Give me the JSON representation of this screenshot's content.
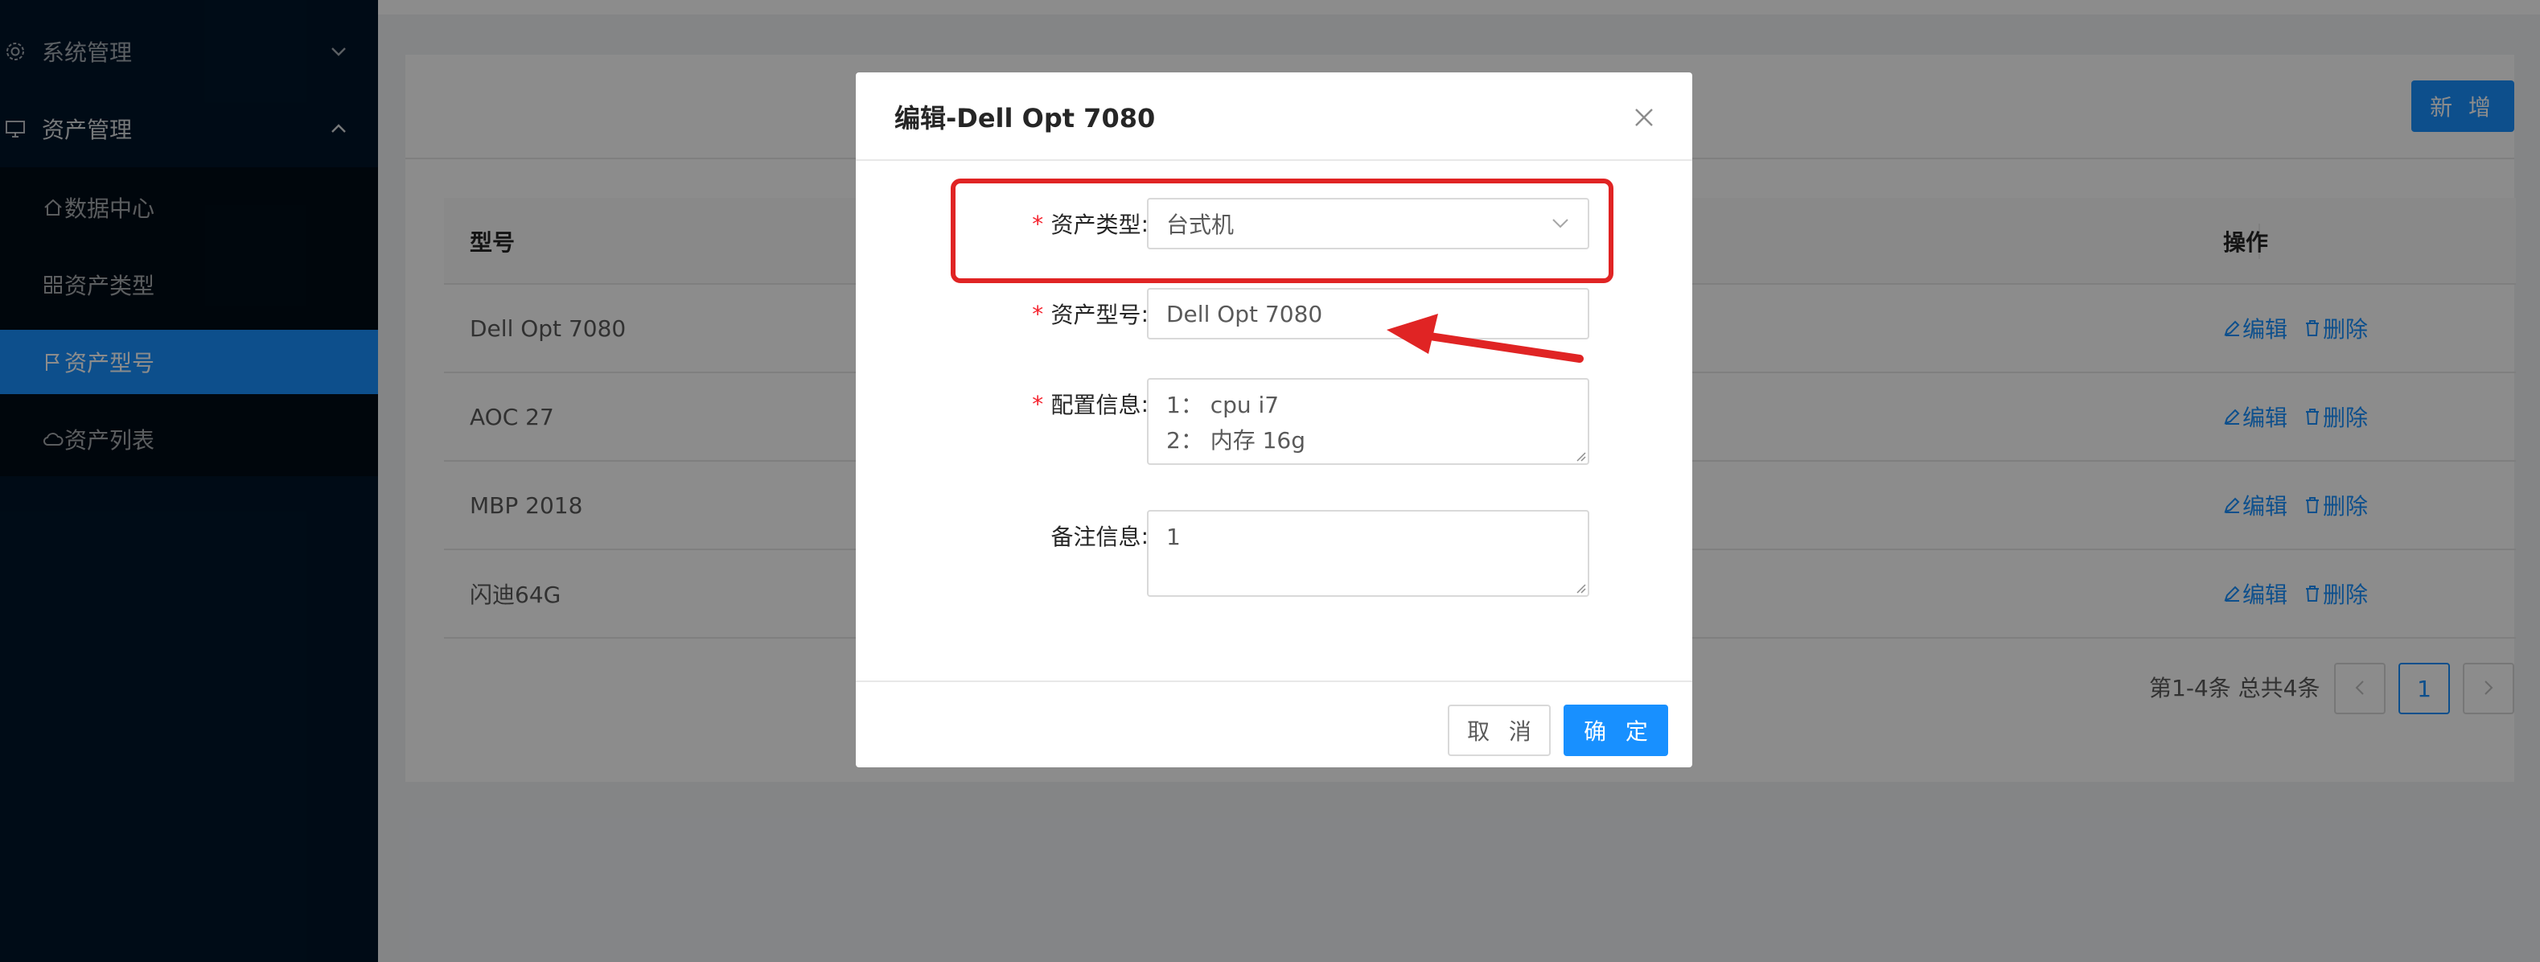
{
  "sidebar": {
    "system_menu": {
      "label": "系统管理",
      "icon": "gear-icon"
    },
    "asset_menu": {
      "label": "资产管理",
      "icon": "desktop-icon"
    },
    "items": [
      {
        "label": "数据中心",
        "icon": "home-icon"
      },
      {
        "label": "资产类型",
        "icon": "appstore-icon"
      },
      {
        "label": "资产型号",
        "icon": "flag-icon",
        "active": true
      },
      {
        "label": "资产列表",
        "icon": "cloud-icon"
      }
    ]
  },
  "toolbar": {
    "new_label": "新 增"
  },
  "table": {
    "columns": [
      "型号",
      "操作"
    ],
    "rows": [
      {
        "model": "Dell Opt 7080",
        "edit": "编辑",
        "delete": "删除"
      },
      {
        "model": "AOC 27",
        "edit": "编辑",
        "delete": "删除"
      },
      {
        "model": "MBP 2018",
        "edit": "编辑",
        "delete": "删除"
      },
      {
        "model": "闪迪64G",
        "edit": "编辑",
        "delete": "删除"
      }
    ]
  },
  "pagination": {
    "summary": "第1-4条 总共4条",
    "current_page": "1",
    "prev": "<",
    "next": ">"
  },
  "modal": {
    "title": "编辑-Dell Opt 7080",
    "fields": {
      "asset_type": {
        "label": "资产类型",
        "value": "台式机",
        "required": true
      },
      "asset_model": {
        "label": "资产型号",
        "value": "Dell Opt 7080",
        "required": true
      },
      "config_info": {
        "label": "配置信息",
        "line1": "1： cpu i7",
        "line2": "2： 内存 16g",
        "required": true
      },
      "remark_info": {
        "label": "备注信息",
        "value": "1",
        "required": false
      }
    },
    "cancel_label": "取 消",
    "ok_label": "确 定"
  },
  "colors": {
    "primary": "#1890ff",
    "sidebar_bg": "#001529",
    "annotation_red": "#e02424"
  }
}
